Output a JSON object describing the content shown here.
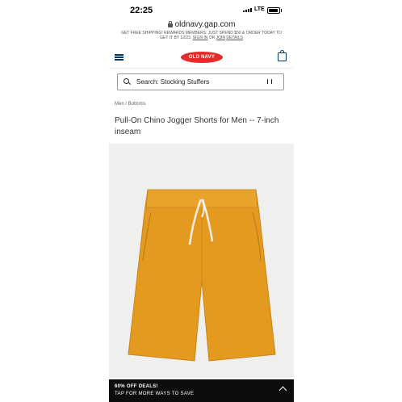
{
  "status_bar": {
    "time": "22:25",
    "network": "LTE"
  },
  "browser": {
    "url": "oldnavy.gap.com"
  },
  "promo_banner": {
    "line1": "GET FREE SHIPPING! REWARDS MEMBERS: JUST SPEND $50 & ORDER TODAY TO",
    "line2_prefix": "GET IT BY 12/23.",
    "sign_in": "SIGN IN",
    "or": "OR",
    "join": "JOIN",
    "details": "details"
  },
  "header": {
    "logo": "OLD NAVY",
    "icons": [
      "menu-icon",
      "shopping-bag-icon"
    ]
  },
  "search": {
    "label": "Search: Stocking Stuffers",
    "icons": [
      "search-icon",
      "pause-icon"
    ]
  },
  "breadcrumb": "Men / Bottoms",
  "product": {
    "title": "Pull-On Chino Jogger Shorts for Men -- 7-inch inseam",
    "image_color": "#e39a1f"
  },
  "deal_bar": {
    "title": "60% OFF DEALS!",
    "subtitle": "TAP FOR MORE WAYS TO SAVE",
    "icon": "chevron-up-icon"
  },
  "colors": {
    "brand_red": "#e52c2c",
    "navy": "#003764"
  }
}
